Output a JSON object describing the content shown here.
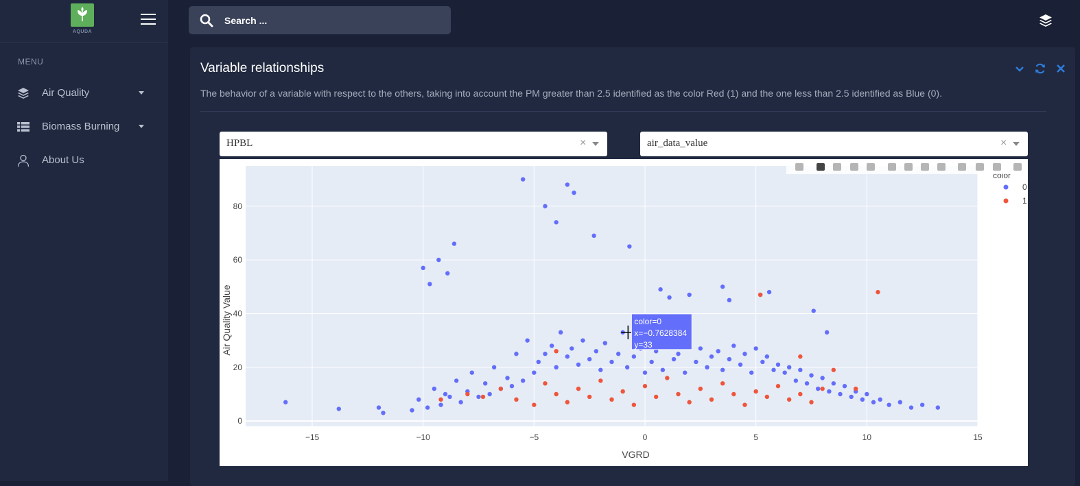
{
  "app": {
    "logo_text": "AQUDA"
  },
  "sidebar": {
    "menu_label": "MENU",
    "items": [
      {
        "label": "Air Quality",
        "icon": "layers-icon",
        "has_dropdown": true
      },
      {
        "label": "Biomass Burning",
        "icon": "list-icon",
        "has_dropdown": true
      },
      {
        "label": "About Us",
        "icon": "user-icon",
        "has_dropdown": false
      }
    ]
  },
  "search": {
    "placeholder": "Search ..."
  },
  "card": {
    "title": "Variable relationships",
    "description": "The behavior of a variable with respect to the others, taking into account the PM greater than 2.5 identified as the color Red (1) and the one less than 2.5 identified as Blue (0).",
    "tools": [
      "chevron-down-icon",
      "refresh-icon",
      "close-icon"
    ]
  },
  "selects": {
    "x_variable": "HPBL",
    "y_variable": "air_data_value",
    "clear_symbol": "×"
  },
  "colors": {
    "series_0": "#636efa",
    "series_1": "#ef553b",
    "plot_bg": "#e5ecf6",
    "accent": "#2f7bd9"
  },
  "chart_data": {
    "type": "scatter",
    "xlabel": "VGRD",
    "ylabel": "Air Quality Value",
    "xlim": [
      -18,
      15
    ],
    "ylim": [
      -2,
      95
    ],
    "x_ticks": [
      -15,
      -10,
      -5,
      0,
      5,
      10,
      15
    ],
    "x_tick_labels": [
      "−15",
      "−10",
      "−5",
      "0",
      "5",
      "10",
      "15"
    ],
    "y_ticks": [
      0,
      20,
      40,
      60,
      80
    ],
    "grid": true,
    "legend": {
      "title": "color",
      "placement": "top-right",
      "entries": [
        "0",
        "1"
      ]
    },
    "series": [
      {
        "name": "0",
        "color": "#636efa",
        "x": [
          -16.2,
          -13.8,
          -12,
          -11.8,
          -10.5,
          -10.2,
          -9.8,
          -9.5,
          -9.2,
          -9.0,
          -8.8,
          -8.5,
          -8.3,
          -8.0,
          -7.8,
          -7.5,
          -7.2,
          -7.0,
          -6.8,
          -6.5,
          -6.2,
          -6.0,
          -5.8,
          -5.5,
          -5.3,
          -5.0,
          -4.8,
          -4.5,
          -4.2,
          -4.0,
          -3.8,
          -3.5,
          -3.3,
          -3.0,
          -2.8,
          -2.5,
          -2.2,
          -2.0,
          -1.8,
          -1.5,
          -1.2,
          -1.0,
          -0.8,
          -0.5,
          -0.2,
          0,
          0.3,
          0.5,
          0.8,
          1.0,
          1.3,
          1.5,
          1.8,
          2.0,
          2.3,
          2.5,
          2.8,
          3.0,
          3.3,
          3.5,
          3.8,
          4.0,
          4.3,
          4.5,
          4.8,
          5.0,
          5.3,
          5.5,
          5.8,
          6.0,
          6.3,
          6.5,
          6.8,
          7.0,
          7.3,
          7.5,
          7.8,
          8.0,
          8.3,
          8.5,
          8.8,
          9.0,
          9.3,
          9.5,
          9.8,
          10.0,
          10.3,
          10.6,
          11.0,
          11.5,
          12.0,
          12.5,
          13.2,
          -10.0,
          -9.7,
          -9.3,
          -8.9,
          -8.6,
          -5.5,
          -4.5,
          -4.0,
          -3.5,
          -3.2,
          -2.3,
          -0.7,
          0.7,
          1.1,
          2.0,
          3.5,
          3.8,
          5.2,
          5.6,
          7.6,
          8.2
        ],
        "y": [
          7,
          4.5,
          5,
          3,
          4,
          8,
          5,
          12,
          6,
          10,
          9,
          15,
          7,
          11,
          18,
          9,
          14,
          10,
          20,
          12,
          16,
          13,
          25,
          15,
          30,
          18,
          22,
          25,
          28,
          20,
          33,
          24,
          27,
          21,
          30,
          23,
          26,
          19,
          29,
          22,
          25,
          33,
          20,
          24,
          27,
          18,
          22,
          26,
          19,
          28,
          23,
          25,
          18,
          30,
          22,
          27,
          20,
          24,
          26,
          19,
          23,
          28,
          21,
          25,
          18,
          27,
          22,
          24,
          19,
          21,
          18,
          20,
          15,
          19,
          14,
          17,
          12,
          16,
          11,
          14,
          10,
          13,
          9,
          11,
          8,
          10,
          7,
          8,
          6,
          7,
          5,
          6,
          5,
          57,
          51,
          60,
          55,
          66,
          90,
          80,
          74,
          88,
          85,
          69,
          65,
          49,
          46,
          47,
          50,
          45,
          47,
          48,
          41,
          33
        ]
      },
      {
        "name": "1",
        "color": "#ef553b",
        "x": [
          -9.2,
          -8.0,
          -7.3,
          -6.5,
          -5.8,
          -5.0,
          -4.5,
          -4.0,
          -3.5,
          -3.0,
          -2.5,
          -2.0,
          -1.5,
          -1.0,
          -0.5,
          0,
          0.5,
          1.0,
          1.5,
          2.0,
          2.5,
          3.0,
          3.5,
          4.0,
          4.5,
          5.0,
          5.5,
          6.0,
          6.5,
          7.0,
          7.5,
          8.0,
          8.5,
          9.5,
          5.2,
          10.5,
          -4.0,
          7.0
        ],
        "y": [
          8,
          10,
          9,
          12,
          8,
          6,
          14,
          10,
          7,
          12,
          9,
          15,
          8,
          11,
          6,
          13,
          9,
          16,
          10,
          7,
          12,
          8,
          14,
          10,
          6,
          11,
          9,
          13,
          8,
          10,
          7,
          12,
          19,
          12,
          47,
          48,
          26,
          24
        ]
      }
    ],
    "hover": {
      "lines": [
        "color=0",
        "x=−0.7628384",
        "y=33"
      ],
      "x": -0.7628384,
      "y": 33
    }
  }
}
